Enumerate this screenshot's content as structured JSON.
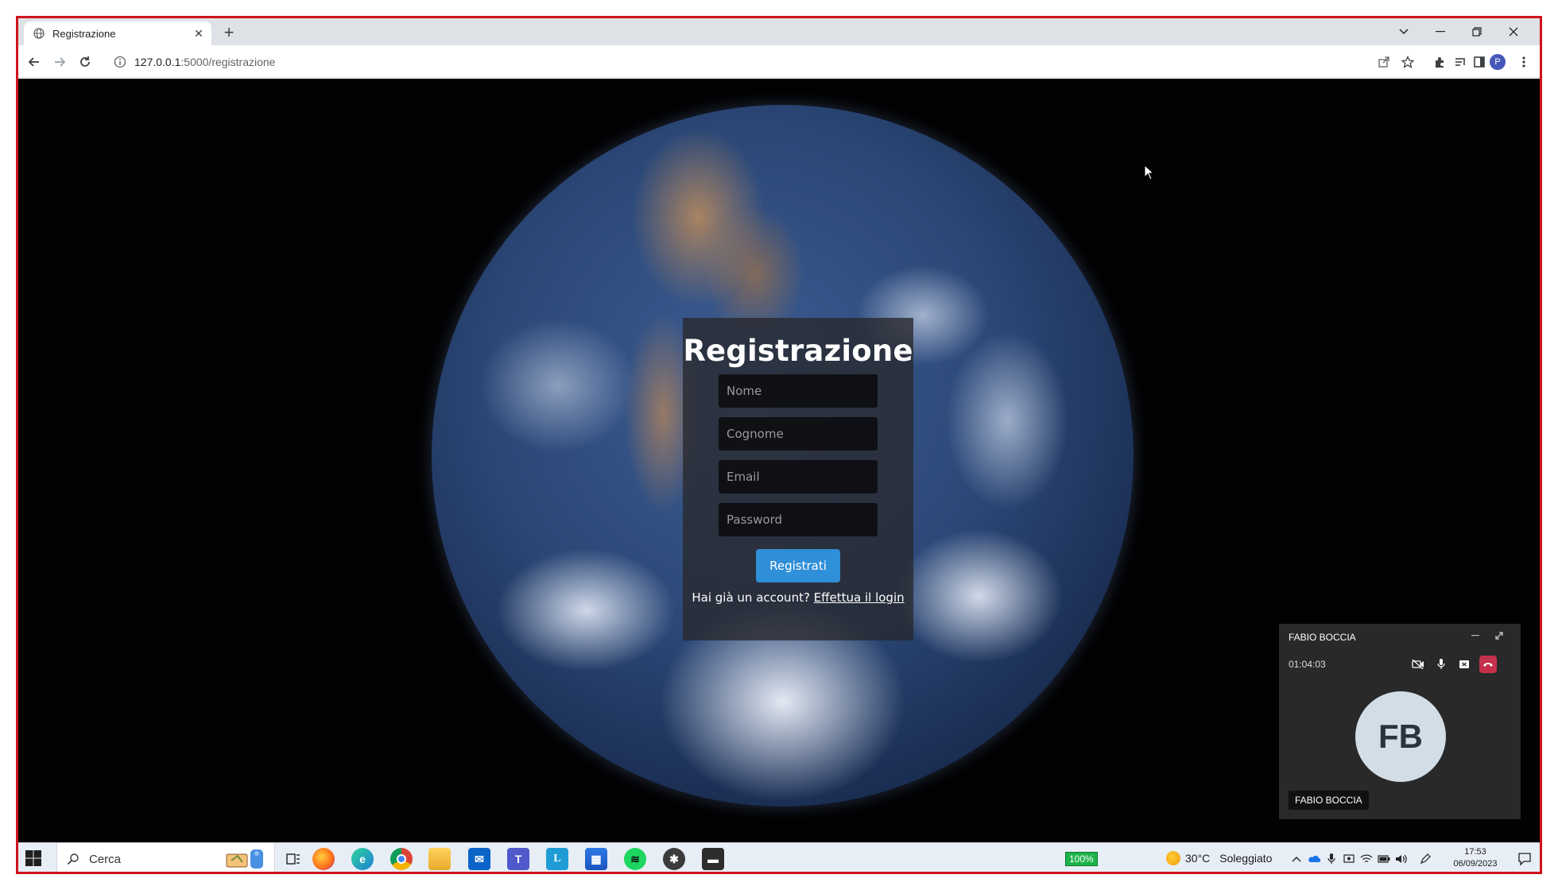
{
  "browser": {
    "tab_title": "Registrazione",
    "url_host": "127.0.0.1",
    "url_path": ":5000/registrazione",
    "profile_initial": "P"
  },
  "form": {
    "title": "Registrazione",
    "fields": {
      "nome_placeholder": "Nome",
      "cognome_placeholder": "Cognome",
      "email_placeholder": "Email",
      "password_placeholder": "Password"
    },
    "submit_label": "Registrati",
    "login_prompt": "Hai già un account?",
    "login_link": "Effettua il login"
  },
  "call": {
    "caller_name": "FABIO BOCCIA",
    "duration": "01:04:03",
    "initials": "FB",
    "participant_label": "FABIO BOCCIA"
  },
  "taskbar": {
    "search_placeholder": "Cerca",
    "battery": "100%",
    "weather_temp": "30°C",
    "weather_desc": "Soleggiato",
    "time": "17:53",
    "date": "06/09/2023"
  },
  "colors": {
    "accent_button": "#2f8fd8",
    "hangup": "#c4314b",
    "frame_border": "#d0121b"
  }
}
